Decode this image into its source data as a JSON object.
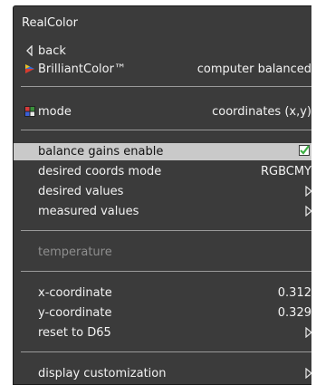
{
  "title": "RealColor",
  "items": {
    "back": "back",
    "brilliantcolor": {
      "label": "BrilliantColor™",
      "value": "computer balanced"
    },
    "mode": {
      "label": "mode",
      "value": "coordinates (x,y)"
    },
    "balance_gains": {
      "label": "balance gains enable",
      "checked": true
    },
    "desired_coords_mode": {
      "label": "desired coords mode",
      "value": "RGBCMY"
    },
    "desired_values": "desired values",
    "measured_values": "measured values",
    "temperature": "temperature",
    "x_coordinate": {
      "label": "x-coordinate",
      "value": "0.312"
    },
    "y_coordinate": {
      "label": "y-coordinate",
      "value": "0.329"
    },
    "reset": "reset to D65",
    "display_customization": "display customization"
  },
  "colors": {
    "panel_bg": "#3b3b3b",
    "highlight_bg": "#c9c9c9",
    "check_green": "#3cb043",
    "disabled_text": "#8e8e8e"
  }
}
